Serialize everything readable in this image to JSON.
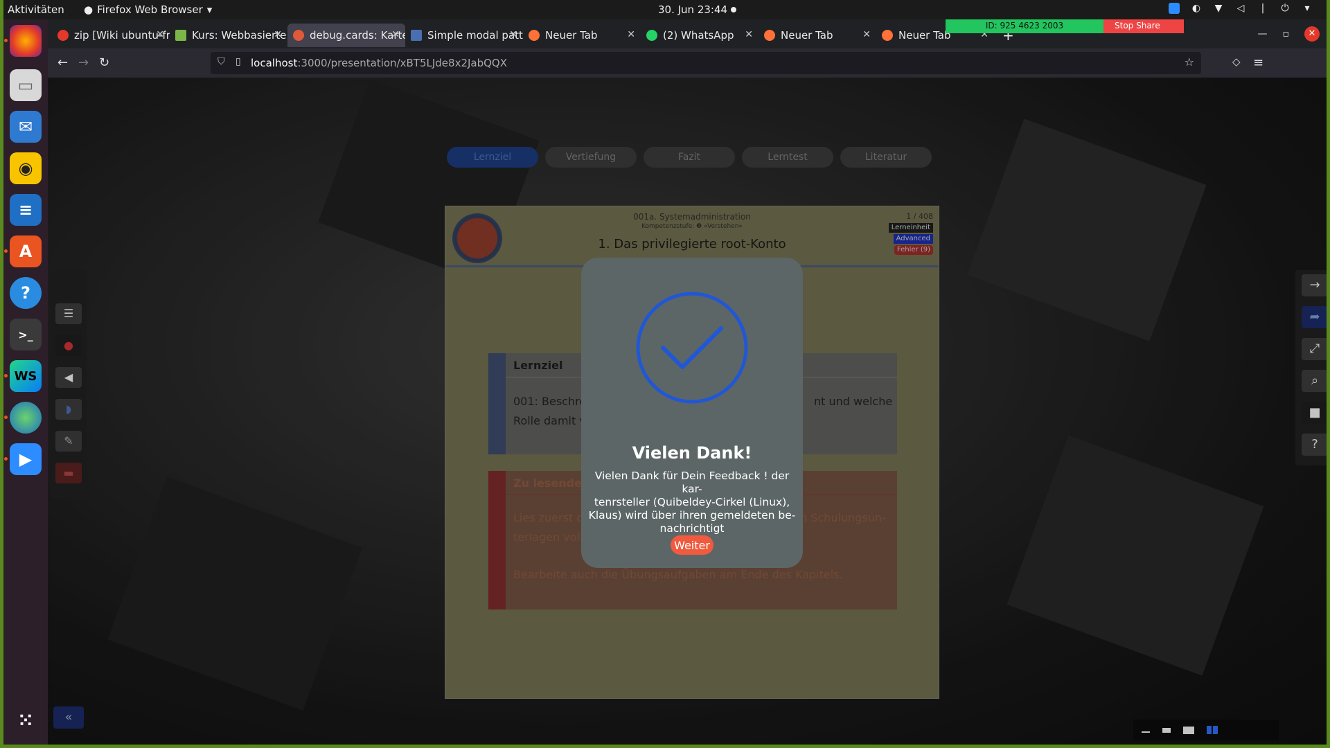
{
  "topbar": {
    "activities": "Aktivitäten",
    "app": "Firefox Web Browser",
    "clock": "30. Jun  23:44"
  },
  "share": {
    "id": "ID: 925 4623 2003",
    "stop": "Stop Share"
  },
  "tabs": [
    {
      "label": "zip [Wiki ubuntu-fr]",
      "color": "#e2392b"
    },
    {
      "label": "Kurs: Webbasierte Syst",
      "color": "#7ab648"
    },
    {
      "label": "debug.cards: Kartensc",
      "color": "#e05a3a"
    },
    {
      "label": "Simple modal pattern",
      "color": "#4a6eb2"
    },
    {
      "label": "Neuer Tab",
      "color": "#ff7139"
    },
    {
      "label": "(2) WhatsApp",
      "color": "#25d366"
    },
    {
      "label": "Neuer Tab",
      "color": "#ff7139"
    },
    {
      "label": "Neuer Tab",
      "color": "#ff7139"
    }
  ],
  "address": {
    "host": "localhost",
    "path": ":3000/presentation/xBT5LJde8x2JabQQX"
  },
  "pills": [
    "Lernziel",
    "Vertiefung",
    "Fazit",
    "Lerntest",
    "Literatur"
  ],
  "card": {
    "course": "001a. Systemadministration",
    "competence": "Kompetenzstufe: ❷ «Verstehen»",
    "title": "1. Das privilegierte root-Konto",
    "counter": "1 / 408",
    "badges": [
      "Lerneinheit",
      "Advanced",
      "Fehler (9)"
    ],
    "box1_title": "Lernziel",
    "box1_line1": "001: Beschreib",
    "box1_line1_tail": "nt und welche",
    "box1_line2": "Rolle damit ve",
    "box2_title": "Zu lesendes",
    "box2_line1": "Lies zuerst di",
    "box2_line1_tail": "n Schulungsun-",
    "box2_line2": "terlagen vollst",
    "box2_line3": "Bearbeite auch die Übungsaufgaben am Ende des Kapitels."
  },
  "modal": {
    "title": "Vielen Dank!",
    "line1": "Vielen Dank für Dein Feedback ! der kar-",
    "line2": "tenrsteller (Quibeldey-Cirkel (Linux),",
    "line3": "Klaus) wird über ihren gemeldeten be-",
    "line4": "nachrichtigt",
    "button": "Weiter"
  }
}
